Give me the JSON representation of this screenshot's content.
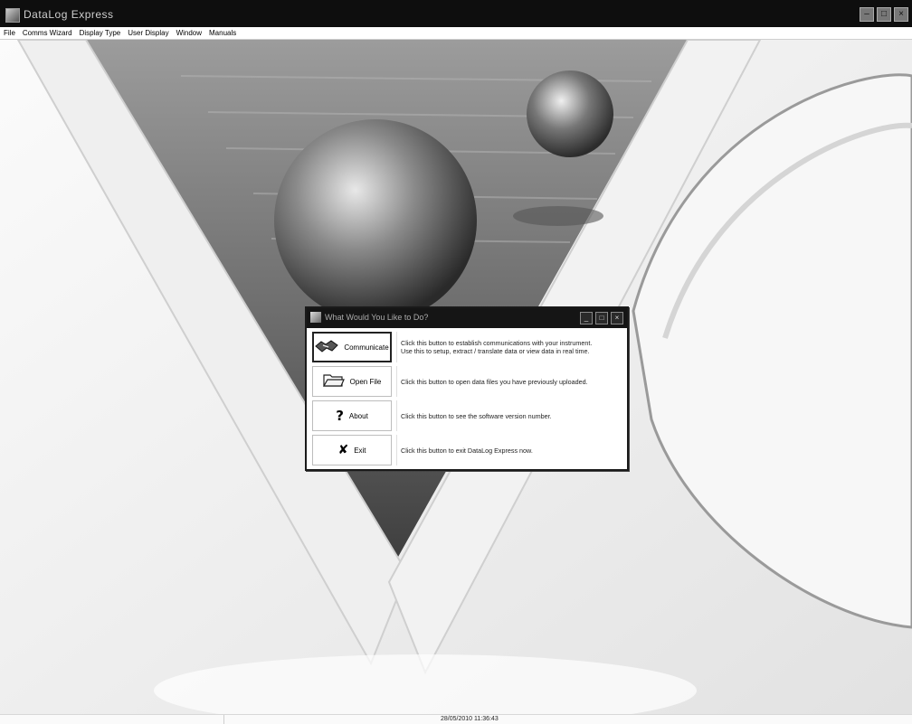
{
  "window": {
    "title": "DataLog Express",
    "controls": [
      "minimize",
      "maximize",
      "close"
    ]
  },
  "menubar": {
    "items": [
      "File",
      "Comms Wizard",
      "Display Type",
      "User Display",
      "Window",
      "Manuals"
    ]
  },
  "dialog": {
    "title": "What Would You Like to Do?",
    "options": [
      {
        "label": "Communicate",
        "icon": "handshake-icon",
        "description_line1": "Click this button to establish communications with your instrument.",
        "description_line2": "Use this to setup, extract / translate data or view data in real time."
      },
      {
        "label": "Open File",
        "icon": "folder-icon",
        "description_line1": "Click this button to open data files you have previously uploaded.",
        "description_line2": ""
      },
      {
        "label": "About",
        "icon": "question-icon",
        "description_line1": "Click this button to see the software version number.",
        "description_line2": ""
      },
      {
        "label": "Exit",
        "icon": "x-mark-icon",
        "description_line1": "Click this button to exit DataLog Express now.",
        "description_line2": ""
      }
    ]
  },
  "statusbar": {
    "datetime": "28/05/2010 11:36:43"
  }
}
